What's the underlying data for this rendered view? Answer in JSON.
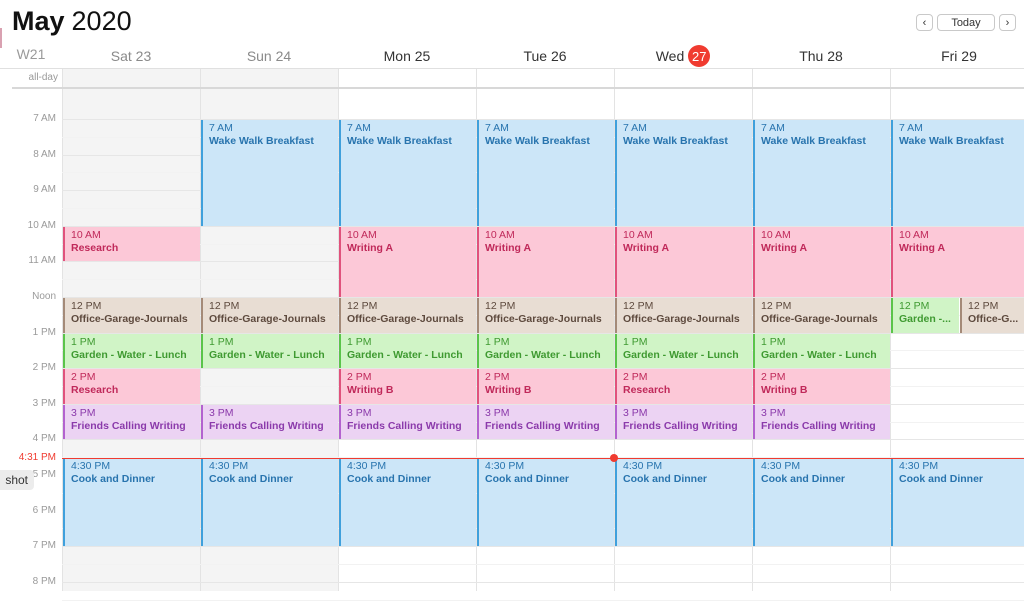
{
  "header": {
    "month": "May",
    "year": "2020",
    "prev_label": "‹",
    "today_label": "Today",
    "next_label": "›"
  },
  "week_number": "W21",
  "days": [
    {
      "label": "Sat 23",
      "weekend": true
    },
    {
      "label": "Sun 24",
      "weekend": true
    },
    {
      "label": "Mon 25",
      "weekend": false
    },
    {
      "label": "Tue 26",
      "weekend": false
    },
    {
      "label": "Wed",
      "badge": "27",
      "weekend": false,
      "today": true
    },
    {
      "label": "Thu 28",
      "weekend": false
    },
    {
      "label": "Fri 29",
      "weekend": false
    }
  ],
  "allday_label": "all-day",
  "hours": [
    "7 AM",
    "8 AM",
    "9 AM",
    "10 AM",
    "11 AM",
    "Noon",
    "1 PM",
    "2 PM",
    "3 PM",
    "4 PM",
    "5 PM",
    "6 PM",
    "7 PM",
    "8 PM"
  ],
  "now": {
    "label": "4:31 PM",
    "hour": 16.52
  },
  "tooltip": "shot",
  "colors": {
    "today_badge": "#f03b30",
    "now_line": "#f03b30",
    "blue": "#cce6f8",
    "pink": "#fcc8d7",
    "brown": "#e8ddd3",
    "green": "#d0f4c6",
    "purple": "#ecd3f3"
  },
  "events": [
    {
      "day": 0,
      "start": 10,
      "end": 11,
      "time": "10 AM",
      "title": "Research",
      "color": "pink"
    },
    {
      "day": 0,
      "start": 12,
      "end": 13,
      "time": "12 PM",
      "title": "Office-Garage-Journals",
      "color": "brown"
    },
    {
      "day": 0,
      "start": 13,
      "end": 14,
      "time": "1 PM",
      "title": "Garden - Water - Lunch",
      "color": "green"
    },
    {
      "day": 0,
      "start": 14,
      "end": 15,
      "time": "2 PM",
      "title": "Research",
      "color": "pink"
    },
    {
      "day": 0,
      "start": 15,
      "end": 16,
      "time": "3 PM",
      "title": "Friends Calling Writing",
      "color": "purple"
    },
    {
      "day": 0,
      "start": 16.5,
      "end": 19,
      "time": "4:30 PM",
      "title": "Cook and Dinner",
      "color": "blue"
    },
    {
      "day": 1,
      "start": 7,
      "end": 10,
      "time": "7 AM",
      "title": "Wake Walk Breakfast",
      "color": "blue"
    },
    {
      "day": 1,
      "start": 12,
      "end": 13,
      "time": "12 PM",
      "title": "Office-Garage-Journals",
      "color": "brown"
    },
    {
      "day": 1,
      "start": 13,
      "end": 14,
      "time": "1 PM",
      "title": "Garden - Water - Lunch",
      "color": "green"
    },
    {
      "day": 1,
      "start": 15,
      "end": 16,
      "time": "3 PM",
      "title": "Friends Calling Writing",
      "color": "purple"
    },
    {
      "day": 1,
      "start": 16.5,
      "end": 19,
      "time": "4:30 PM",
      "title": "Cook and Dinner",
      "color": "blue"
    },
    {
      "day": 2,
      "start": 7,
      "end": 10,
      "time": "7 AM",
      "title": "Wake Walk Breakfast",
      "color": "blue"
    },
    {
      "day": 2,
      "start": 10,
      "end": 12,
      "time": "10 AM",
      "title": "Writing A",
      "color": "pink"
    },
    {
      "day": 2,
      "start": 12,
      "end": 13,
      "time": "12 PM",
      "title": "Office-Garage-Journals",
      "color": "brown"
    },
    {
      "day": 2,
      "start": 13,
      "end": 14,
      "time": "1 PM",
      "title": "Garden - Water - Lunch",
      "color": "green"
    },
    {
      "day": 2,
      "start": 14,
      "end": 15,
      "time": "2 PM",
      "title": "Writing B",
      "color": "pink"
    },
    {
      "day": 2,
      "start": 15,
      "end": 16,
      "time": "3 PM",
      "title": "Friends Calling Writing",
      "color": "purple"
    },
    {
      "day": 2,
      "start": 16.5,
      "end": 19,
      "time": "4:30 PM",
      "title": "Cook and Dinner",
      "color": "blue"
    },
    {
      "day": 3,
      "start": 7,
      "end": 10,
      "time": "7 AM",
      "title": "Wake Walk Breakfast",
      "color": "blue"
    },
    {
      "day": 3,
      "start": 10,
      "end": 12,
      "time": "10 AM",
      "title": "Writing A",
      "color": "pink"
    },
    {
      "day": 3,
      "start": 12,
      "end": 13,
      "time": "12 PM",
      "title": "Office-Garage-Journals",
      "color": "brown"
    },
    {
      "day": 3,
      "start": 13,
      "end": 14,
      "time": "1 PM",
      "title": "Garden - Water - Lunch",
      "color": "green"
    },
    {
      "day": 3,
      "start": 14,
      "end": 15,
      "time": "2 PM",
      "title": "Writing B",
      "color": "pink"
    },
    {
      "day": 3,
      "start": 15,
      "end": 16,
      "time": "3 PM",
      "title": "Friends Calling Writing",
      "color": "purple"
    },
    {
      "day": 3,
      "start": 16.5,
      "end": 19,
      "time": "4:30 PM",
      "title": "Cook and Dinner",
      "color": "blue"
    },
    {
      "day": 4,
      "start": 7,
      "end": 10,
      "time": "7 AM",
      "title": "Wake Walk Breakfast",
      "color": "blue"
    },
    {
      "day": 4,
      "start": 10,
      "end": 12,
      "time": "10 AM",
      "title": "Writing A",
      "color": "pink"
    },
    {
      "day": 4,
      "start": 12,
      "end": 13,
      "time": "12 PM",
      "title": "Office-Garage-Journals",
      "color": "brown"
    },
    {
      "day": 4,
      "start": 13,
      "end": 14,
      "time": "1 PM",
      "title": "Garden - Water - Lunch",
      "color": "green"
    },
    {
      "day": 4,
      "start": 14,
      "end": 15,
      "time": "2 PM",
      "title": "Research",
      "color": "pink"
    },
    {
      "day": 4,
      "start": 15,
      "end": 16,
      "time": "3 PM",
      "title": "Friends Calling Writing",
      "color": "purple"
    },
    {
      "day": 4,
      "start": 16.5,
      "end": 19,
      "time": "4:30 PM",
      "title": "Cook and Dinner",
      "color": "blue"
    },
    {
      "day": 5,
      "start": 7,
      "end": 10,
      "time": "7 AM",
      "title": "Wake Walk Breakfast",
      "color": "blue"
    },
    {
      "day": 5,
      "start": 10,
      "end": 12,
      "time": "10 AM",
      "title": "Writing A",
      "color": "pink"
    },
    {
      "day": 5,
      "start": 12,
      "end": 13,
      "time": "12 PM",
      "title": "Office-Garage-Journals",
      "color": "brown"
    },
    {
      "day": 5,
      "start": 13,
      "end": 14,
      "time": "1 PM",
      "title": "Garden - Water - Lunch",
      "color": "green"
    },
    {
      "day": 5,
      "start": 14,
      "end": 15,
      "time": "2 PM",
      "title": "Writing B",
      "color": "pink"
    },
    {
      "day": 5,
      "start": 15,
      "end": 16,
      "time": "3 PM",
      "title": "Friends Calling Writing",
      "color": "purple"
    },
    {
      "day": 5,
      "start": 16.5,
      "end": 19,
      "time": "4:30 PM",
      "title": "Cook and Dinner",
      "color": "blue"
    },
    {
      "day": 6,
      "start": 7,
      "end": 10,
      "time": "7 AM",
      "title": "Wake Walk Breakfast",
      "color": "blue"
    },
    {
      "day": 6,
      "start": 10,
      "end": 12,
      "time": "10 AM",
      "title": "Writing A",
      "color": "pink"
    },
    {
      "day": 6,
      "start": 12,
      "end": 13,
      "time": "12 PM",
      "title": "Garden -...",
      "color": "green",
      "half": 0
    },
    {
      "day": 6,
      "start": 12,
      "end": 13,
      "time": "12 PM",
      "title": "Office-G...",
      "color": "brown",
      "half": 1
    },
    {
      "day": 6,
      "start": 16.5,
      "end": 19,
      "time": "4:30 PM",
      "title": "Cook and Dinner",
      "color": "blue"
    }
  ]
}
